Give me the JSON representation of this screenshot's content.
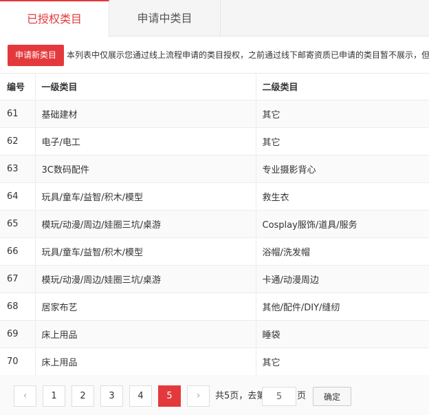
{
  "tabs": [
    {
      "label": "已授权类目"
    },
    {
      "label": "申请中类目"
    }
  ],
  "toolbar": {
    "apply_label": "申请新类目",
    "notice": "本列表中仅展示您通过线上流程申请的类目授权，之前通过线下邮寄资质已申请的类目暂不展示，但"
  },
  "table": {
    "headers": [
      "编号",
      "一级类目",
      "二级类目"
    ],
    "rows": [
      {
        "id": "61",
        "level1": "基础建材",
        "level2": "其它"
      },
      {
        "id": "62",
        "level1": "电子/电工",
        "level2": "其它"
      },
      {
        "id": "63",
        "level1": "3C数码配件",
        "level2": "专业摄影背心"
      },
      {
        "id": "64",
        "level1": "玩具/童车/益智/积木/模型",
        "level2": "救生衣"
      },
      {
        "id": "65",
        "level1": "模玩/动漫/周边/娃圈三坑/桌游",
        "level2": "Cosplay服饰/道具/服务"
      },
      {
        "id": "66",
        "level1": "玩具/童车/益智/积木/模型",
        "level2": "浴帽/洗发帽"
      },
      {
        "id": "67",
        "level1": "模玩/动漫/周边/娃圈三坑/桌游",
        "level2": "卡通/动漫周边"
      },
      {
        "id": "68",
        "level1": "居家布艺",
        "level2": "其他/配件/DIY/缝纫"
      },
      {
        "id": "69",
        "level1": "床上用品",
        "level2": "睡袋"
      },
      {
        "id": "70",
        "level1": "床上用品",
        "level2": "其它"
      }
    ]
  },
  "pagination": {
    "prev": "‹",
    "next": "›",
    "pages": [
      "1",
      "2",
      "3",
      "4",
      "5"
    ],
    "current": "5",
    "total_text": "共5页，去第",
    "goto_value": "5",
    "page_suffix": "页",
    "confirm_label": "确定"
  },
  "colors": {
    "accent": "#e4393c"
  }
}
